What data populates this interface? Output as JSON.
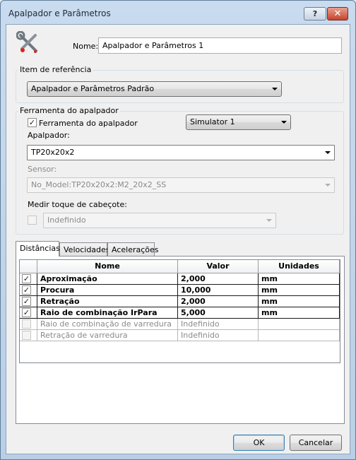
{
  "window": {
    "title": "Apalpador e Parâmetros",
    "help_label": "?",
    "close_label": "✕"
  },
  "icon": "tools-icon",
  "name_field": {
    "label": "Nome:",
    "value": "Apalpador e Parâmetros 1"
  },
  "reference": {
    "group_title": "Item de referência",
    "selected": "Apalpador e Parâmetros Padrão"
  },
  "probe_tool": {
    "group_title": "Ferramenta do apalpador",
    "checkbox_label": "Ferramenta do apalpador",
    "checkbox_checked": true,
    "simulator_selected": "Simulator 1",
    "probe_label": "Apalpador:",
    "probe_selected": "TP20x20x2",
    "sensor_label": "Sensor:",
    "sensor_selected": "No_Model:TP20x20x2:M2_20x2_SS",
    "head_touch_label": "Medir toque de cabeçote:",
    "head_touch_checked": false,
    "head_touch_selected": "Indefinido"
  },
  "tabs": [
    {
      "label": "Distâncias",
      "active": true
    },
    {
      "label": "Velocidades",
      "active": false
    },
    {
      "label": "Acelerações",
      "active": false
    }
  ],
  "table": {
    "columns": [
      "Nome",
      "Valor",
      "Unidades"
    ],
    "rows": [
      {
        "checked": true,
        "name": "Aproximação",
        "value": "2,000",
        "unit": "mm",
        "enabled": true
      },
      {
        "checked": true,
        "name": "Procura",
        "value": "10,000",
        "unit": "mm",
        "enabled": true
      },
      {
        "checked": true,
        "name": "Retração",
        "value": "2,000",
        "unit": "mm",
        "enabled": true
      },
      {
        "checked": true,
        "name": "Raio de combinação IrPara",
        "value": "5,000",
        "unit": "mm",
        "enabled": true
      },
      {
        "checked": false,
        "name": "Raio de combinação de varredura",
        "value": "Indefinido",
        "unit": "",
        "enabled": false
      },
      {
        "checked": false,
        "name": "Retração de varredura",
        "value": "Indefinido",
        "unit": "",
        "enabled": false
      }
    ]
  },
  "buttons": {
    "ok": "OK",
    "cancel": "Cancelar"
  },
  "colors": {
    "title_bar": "#c9dbee",
    "close_button": "#c4452c",
    "default_button_border": "#3c7fb1"
  }
}
